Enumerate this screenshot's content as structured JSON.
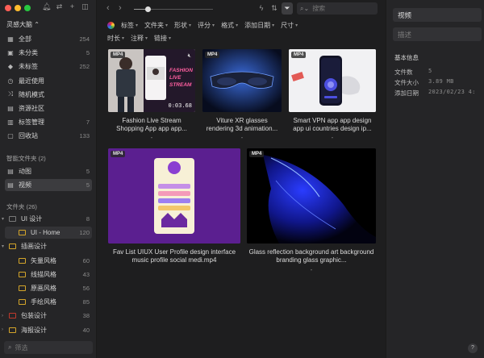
{
  "sidebar": {
    "library_title": "灵感大脑 ⌃",
    "main_items": [
      {
        "icon": "grid-icon",
        "glyph": "▦",
        "label": "全部",
        "count": "254"
      },
      {
        "icon": "uncategorized-icon",
        "glyph": "▣",
        "label": "未分类",
        "count": "5"
      },
      {
        "icon": "untagged-icon",
        "glyph": "◆",
        "label": "未标签",
        "count": "252"
      },
      {
        "icon": "recent-icon",
        "glyph": "◷",
        "label": "最近使用",
        "count": ""
      },
      {
        "icon": "shuffle-icon",
        "glyph": "⤨",
        "label": "随机模式",
        "count": ""
      },
      {
        "icon": "community-icon",
        "glyph": "▤",
        "label": "资源社区",
        "count": ""
      },
      {
        "icon": "tag-manage-icon",
        "glyph": "▥",
        "label": "标签管理",
        "count": "7"
      },
      {
        "icon": "trash-icon",
        "glyph": "▢",
        "label": "回收站",
        "count": "133"
      }
    ],
    "smart_section": "智能文件夹 (2)",
    "smart_items": [
      {
        "label": "动图",
        "count": "5"
      },
      {
        "label": "视频",
        "count": "5"
      }
    ],
    "folder_section": "文件夹 (26)",
    "folders": [
      {
        "label": "UI 设计",
        "count": "8",
        "color": "#7a7a7a",
        "level": 0,
        "arrow": "▾"
      },
      {
        "label": "UI - Home",
        "count": "120",
        "color": "#d4a52a",
        "level": 1,
        "arrow": ""
      },
      {
        "label": "插画设计",
        "count": "",
        "color": "#d4a52a",
        "level": 0,
        "arrow": "▾"
      },
      {
        "label": "矢量风格",
        "count": "60",
        "color": "#d4a52a",
        "level": 1,
        "arrow": ""
      },
      {
        "label": "线描风格",
        "count": "43",
        "color": "#d4a52a",
        "level": 1,
        "arrow": ""
      },
      {
        "label": "原画风格",
        "count": "56",
        "color": "#d4a52a",
        "level": 1,
        "arrow": ""
      },
      {
        "label": "手绘风格",
        "count": "85",
        "color": "#d4a52a",
        "level": 1,
        "arrow": ""
      },
      {
        "label": "包装设计",
        "count": "38",
        "color": "#c0392b",
        "level": 0,
        "arrow": "›"
      },
      {
        "label": "海报设计",
        "count": "40",
        "color": "#d4a52a",
        "level": 0,
        "arrow": "›"
      }
    ],
    "search_placeholder": "筛选"
  },
  "toolbar": {
    "back_glyph": "‹",
    "forward_glyph": "›",
    "zoom_level": 0.18,
    "search_placeholder": "搜索"
  },
  "filters": {
    "row1": [
      "标签",
      "文件夹",
      "形状",
      "评分",
      "格式",
      "添加日期",
      "尺寸"
    ],
    "row2": [
      "时长",
      "注释",
      "链接"
    ]
  },
  "items": [
    {
      "badge": "MP4",
      "title": "Fashion Live Stream Shopping App app app...",
      "sub": "-",
      "duration": "0:03.68"
    },
    {
      "badge": "MP4",
      "title": "Viture XR glasses rendering 3d animation...",
      "sub": "-",
      "duration": ""
    },
    {
      "badge": "MP4",
      "title": "Smart VPN app app design app ui countries design ip...",
      "sub": "-",
      "duration": ""
    },
    {
      "badge": "MP4",
      "title": "Fav List UIUX User Profile design interface music profile social medi.mp4",
      "sub": "-",
      "duration": ""
    },
    {
      "badge": "MP4",
      "title": "Glass reflection background art background branding glass graphic...",
      "sub": "-",
      "duration": ""
    }
  ],
  "thumb_text": {
    "fashion_line1": "FASHION",
    "fashion_line2": "LIVE",
    "fashion_line3": "STREAM"
  },
  "rpanel": {
    "name_value": "视频",
    "desc_placeholder": "描述",
    "basic_info": "基本信息",
    "rows": [
      {
        "k": "文件数",
        "v": "5"
      },
      {
        "k": "文件大小",
        "v": "3.89 MB"
      },
      {
        "k": "添加日期",
        "v": "2023/02/23 4:"
      }
    ],
    "help": "?"
  },
  "colors": {
    "accent_selected": "#3c3c3f",
    "folder_yellow": "#d4a52a",
    "folder_red": "#c0392b"
  }
}
